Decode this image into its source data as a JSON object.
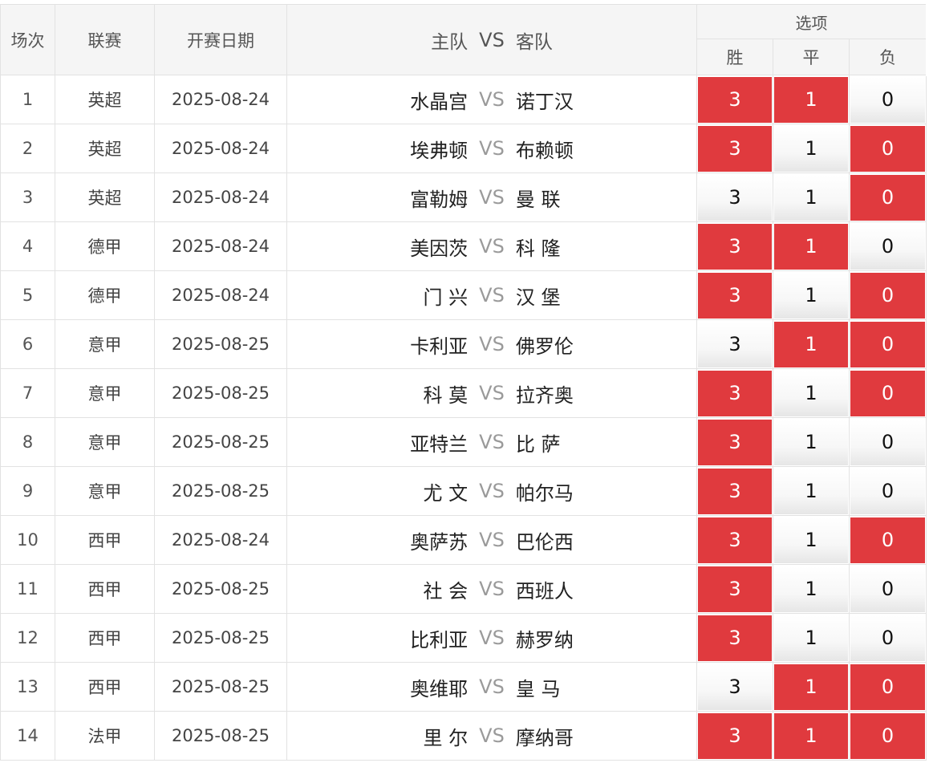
{
  "header": {
    "col_no": "场次",
    "col_league": "联赛",
    "col_date": "开赛日期",
    "col_match_home": "主队",
    "col_match_vs": "VS",
    "col_match_away": "客队",
    "col_options": "选项",
    "opt_win": "胜",
    "opt_draw": "平",
    "opt_lose": "负"
  },
  "colors": {
    "selected": "#e03a3e",
    "unselected": "#f7f7f7"
  },
  "rows": [
    {
      "no": "1",
      "league": "英超",
      "date": "2025-08-24",
      "home": "水晶宫",
      "vs": "VS",
      "away": "诺丁汉",
      "win": "3",
      "draw": "1",
      "lose": "0",
      "sel": [
        true,
        true,
        false
      ]
    },
    {
      "no": "2",
      "league": "英超",
      "date": "2025-08-24",
      "home": "埃弗顿",
      "vs": "VS",
      "away": "布赖顿",
      "win": "3",
      "draw": "1",
      "lose": "0",
      "sel": [
        true,
        false,
        true
      ]
    },
    {
      "no": "3",
      "league": "英超",
      "date": "2025-08-24",
      "home": "富勒姆",
      "vs": "VS",
      "away": "曼 联",
      "win": "3",
      "draw": "1",
      "lose": "0",
      "sel": [
        false,
        false,
        true
      ]
    },
    {
      "no": "4",
      "league": "德甲",
      "date": "2025-08-24",
      "home": "美因茨",
      "vs": "VS",
      "away": "科 隆",
      "win": "3",
      "draw": "1",
      "lose": "0",
      "sel": [
        true,
        true,
        false
      ]
    },
    {
      "no": "5",
      "league": "德甲",
      "date": "2025-08-24",
      "home": "门 兴",
      "vs": "VS",
      "away": "汉 堡",
      "win": "3",
      "draw": "1",
      "lose": "0",
      "sel": [
        true,
        false,
        true
      ]
    },
    {
      "no": "6",
      "league": "意甲",
      "date": "2025-08-25",
      "home": "卡利亚",
      "vs": "VS",
      "away": "佛罗伦",
      "win": "3",
      "draw": "1",
      "lose": "0",
      "sel": [
        false,
        true,
        true
      ]
    },
    {
      "no": "7",
      "league": "意甲",
      "date": "2025-08-25",
      "home": "科 莫",
      "vs": "VS",
      "away": "拉齐奥",
      "win": "3",
      "draw": "1",
      "lose": "0",
      "sel": [
        true,
        false,
        true
      ]
    },
    {
      "no": "8",
      "league": "意甲",
      "date": "2025-08-25",
      "home": "亚特兰",
      "vs": "VS",
      "away": "比 萨",
      "win": "3",
      "draw": "1",
      "lose": "0",
      "sel": [
        true,
        false,
        false
      ]
    },
    {
      "no": "9",
      "league": "意甲",
      "date": "2025-08-25",
      "home": "尤 文",
      "vs": "VS",
      "away": "帕尔马",
      "win": "3",
      "draw": "1",
      "lose": "0",
      "sel": [
        true,
        false,
        false
      ]
    },
    {
      "no": "10",
      "league": "西甲",
      "date": "2025-08-24",
      "home": "奥萨苏",
      "vs": "VS",
      "away": "巴伦西",
      "win": "3",
      "draw": "1",
      "lose": "0",
      "sel": [
        true,
        false,
        true
      ]
    },
    {
      "no": "11",
      "league": "西甲",
      "date": "2025-08-25",
      "home": "社 会",
      "vs": "VS",
      "away": "西班人",
      "win": "3",
      "draw": "1",
      "lose": "0",
      "sel": [
        true,
        false,
        false
      ]
    },
    {
      "no": "12",
      "league": "西甲",
      "date": "2025-08-25",
      "home": "比利亚",
      "vs": "VS",
      "away": "赫罗纳",
      "win": "3",
      "draw": "1",
      "lose": "0",
      "sel": [
        true,
        false,
        false
      ]
    },
    {
      "no": "13",
      "league": "西甲",
      "date": "2025-08-25",
      "home": "奥维耶",
      "vs": "VS",
      "away": "皇 马",
      "win": "3",
      "draw": "1",
      "lose": "0",
      "sel": [
        false,
        true,
        true
      ]
    },
    {
      "no": "14",
      "league": "法甲",
      "date": "2025-08-25",
      "home": "里 尔",
      "vs": "VS",
      "away": "摩纳哥",
      "win": "3",
      "draw": "1",
      "lose": "0",
      "sel": [
        true,
        true,
        true
      ]
    }
  ]
}
